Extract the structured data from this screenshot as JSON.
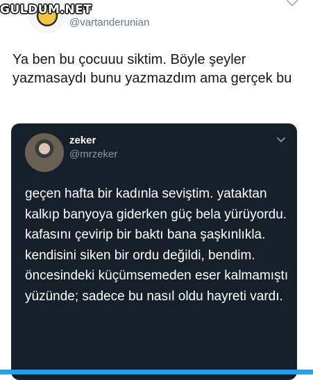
{
  "watermark": "GULDUM.NET",
  "outer_tweet": {
    "display_name": "tan",
    "handle": "@vartanderunian",
    "text": "Ya ben bu çocuuu siktim. Böyle şeyler yazmasaydı bunu yazmazdım ama gerçek bu",
    "menu_icon": "chevron-down-icon"
  },
  "quoted_tweet": {
    "display_name": "zeker",
    "handle": "@mrzeker",
    "text": "geçen hafta bir kadınla seviştim. yataktan kalkıp banyoya giderken güç bela yürüyordu. kafasını çevirip bir baktı bana şaşkınlıkla. kendisini siken bir ordu değildi, bendim. öncesindeki küçümsemeden eser kalmamıştı yüzünde; sadece bu nasıl oldu hayreti vardı.",
    "menu_icon": "chevron-down-icon"
  },
  "colors": {
    "accent": "#1da1f2",
    "quote_background": "#15202b",
    "handle_gray": "#657786"
  }
}
